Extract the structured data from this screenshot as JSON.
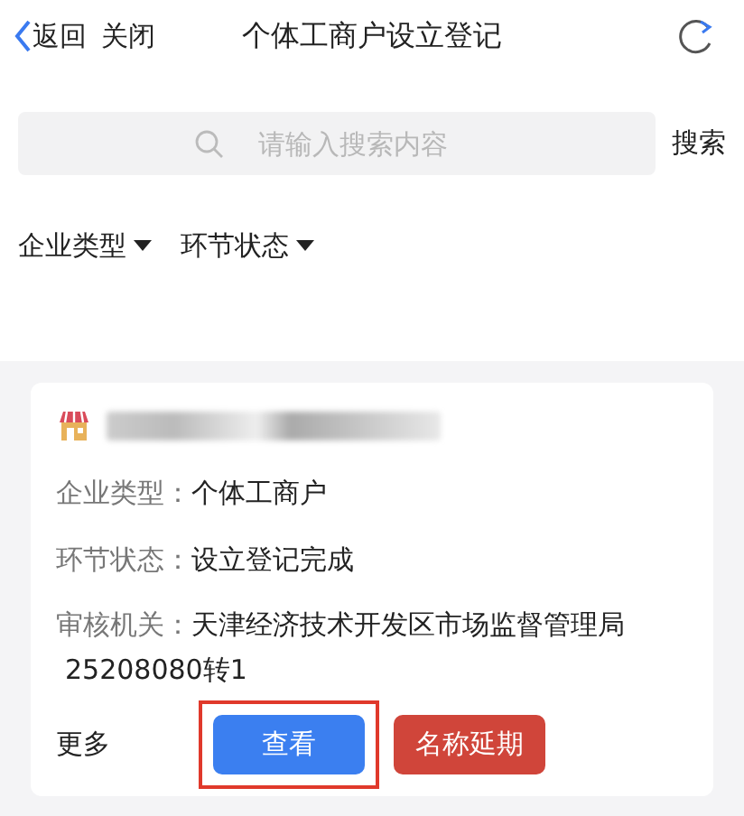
{
  "header": {
    "back": "返回",
    "close": "关闭",
    "title": "个体工商户设立登记"
  },
  "search": {
    "placeholder": "请输入搜索内容",
    "button": "搜索"
  },
  "filters": [
    {
      "label": "企业类型"
    },
    {
      "label": "环节状态"
    }
  ],
  "card": {
    "name_blurred": true,
    "fields": [
      {
        "label": "企业类型：",
        "value": "个体工商户"
      },
      {
        "label": "环节状态：",
        "value": "设立登记完成"
      },
      {
        "label": "审核机关：",
        "value": "天津经济技术开发区市场监督管理局",
        "extra": "25208080转1"
      }
    ],
    "more": "更多",
    "buttons": [
      {
        "label": "查看",
        "kind": "primary",
        "highlighted": true
      },
      {
        "label": "名称延期",
        "kind": "danger",
        "highlighted": false
      }
    ]
  }
}
